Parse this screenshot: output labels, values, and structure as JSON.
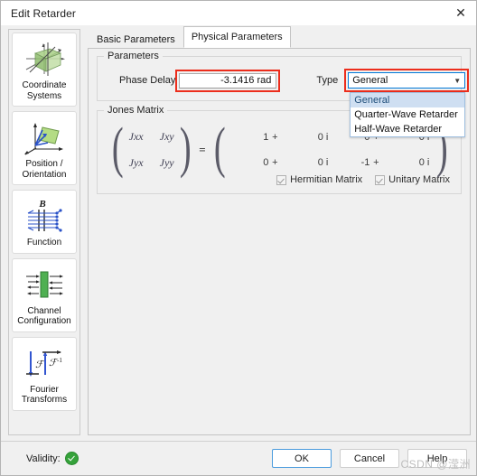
{
  "window": {
    "title": "Edit Retarder",
    "close_icon": "close-icon"
  },
  "sidebar": {
    "items": [
      {
        "label": "Coordinate\nSystems",
        "icon": "coordinate-systems-icon"
      },
      {
        "label": "Position /\nOrientation",
        "icon": "position-orientation-icon"
      },
      {
        "label": "Function",
        "icon": "function-icon"
      },
      {
        "label": "Channel\nConfiguration",
        "icon": "channel-configuration-icon"
      },
      {
        "label": "Fourier\nTransforms",
        "icon": "fourier-transforms-icon"
      }
    ]
  },
  "tabs": [
    {
      "label": "Basic Parameters",
      "active": false
    },
    {
      "label": "Physical Parameters",
      "active": true
    }
  ],
  "parameters": {
    "group_title": "Parameters",
    "phase_delay_label": "Phase Delay",
    "phase_delay_value": "-3.1416 rad",
    "type_label": "Type",
    "type_selected": "General",
    "type_options": [
      {
        "label": "General",
        "selected": true
      },
      {
        "label": "Quarter-Wave Retarder",
        "selected": false
      },
      {
        "label": "Half-Wave Retarder",
        "selected": false
      }
    ],
    "dropdown_arrow_icon": "chevron-down-icon"
  },
  "jones_matrix": {
    "group_title": "Jones Matrix",
    "labels": {
      "xx": "Jxx",
      "xy": "Jxy",
      "yx": "Jyx",
      "yy": "Jyy"
    },
    "equals": "=",
    "cells": {
      "xx_re": "1",
      "xx_op": "+",
      "xx_im": "0 i",
      "xy_re": "0",
      "xy_op": "+",
      "xy_im": "0 i",
      "yx_re": "0",
      "yx_op": "+",
      "yx_im": "0 i",
      "yy_re": "-1",
      "yy_op": "+",
      "yy_im": "0 i"
    },
    "checkboxes": [
      {
        "label": "Hermitian Matrix",
        "checked": true
      },
      {
        "label": "Unitary Matrix",
        "checked": true
      }
    ]
  },
  "footer": {
    "validity_label": "Validity:",
    "validity_state": "valid",
    "ok_label": "OK",
    "cancel_label": "Cancel",
    "help_label": "Help"
  },
  "watermark": "CSDN @滢洲",
  "colors": {
    "highlight_red": "#ec2d1c",
    "focus_blue": "#0078d7",
    "list_selected": "#cfdff2",
    "valid_green": "#35a23a",
    "dialog_bg": "#f0f0f0"
  }
}
